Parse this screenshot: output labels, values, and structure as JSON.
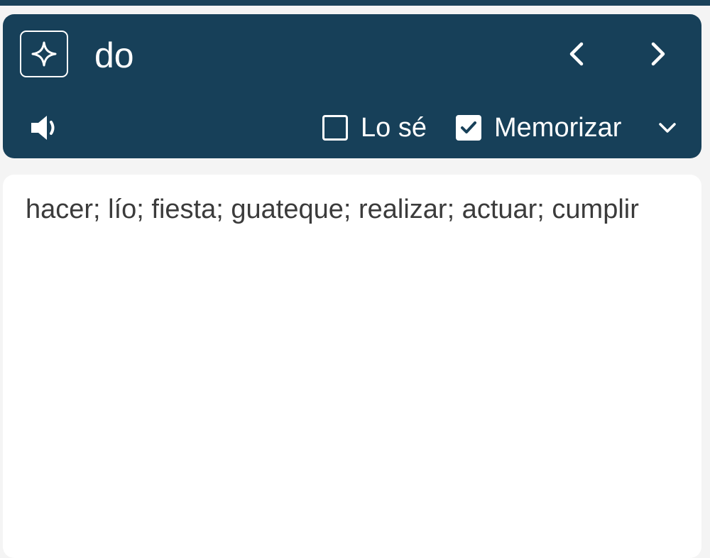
{
  "card": {
    "word": "do",
    "ai_icon": "sparkle-icon",
    "prev_icon": "chevron-left-icon",
    "next_icon": "chevron-right-icon",
    "speaker_icon": "speaker-icon",
    "know_label": "Lo sé",
    "know_checked": false,
    "memorize_label": "Memorizar",
    "memorize_checked": true,
    "dropdown_icon": "chevron-down-icon"
  },
  "translation": {
    "text": "hacer; lío; fiesta; guateque; realizar; actuar; cumplir"
  },
  "colors": {
    "header_bg": "#174059",
    "page_bg": "#f4f4f4",
    "panel_bg": "#ffffff",
    "text": "#3b3b3b"
  }
}
